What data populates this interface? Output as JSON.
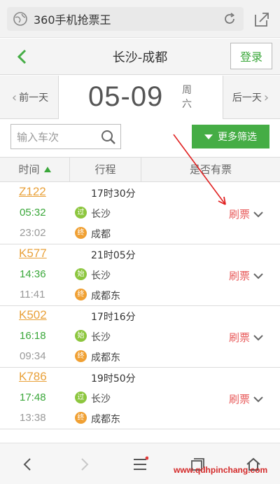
{
  "browser": {
    "url_title": "360手机抢票王"
  },
  "header": {
    "title": "长沙-成都",
    "login_label": "登录"
  },
  "date_nav": {
    "prev_label": "前一天",
    "next_label": "后一天",
    "date": "05-09",
    "weekday_line1": "周",
    "weekday_line2": "六"
  },
  "search": {
    "placeholder": "输入车次"
  },
  "filter": {
    "label": "更多筛选"
  },
  "columns": {
    "time": "时间",
    "route": "行程",
    "availability": "是否有票"
  },
  "trains": [
    {
      "number": "Z122",
      "duration": "17时30分",
      "depart": "05:32",
      "arrive": "23:02",
      "from_badge": "过",
      "from": "长沙",
      "to_badge": "终",
      "to": "成都",
      "action": "刷票"
    },
    {
      "number": "K577",
      "duration": "21时05分",
      "depart": "14:36",
      "arrive": "11:41",
      "from_badge": "始",
      "from": "长沙",
      "to_badge": "终",
      "to": "成都东",
      "action": "刷票"
    },
    {
      "number": "K502",
      "duration": "17时16分",
      "depart": "16:18",
      "arrive": "09:34",
      "from_badge": "始",
      "from": "长沙",
      "to_badge": "终",
      "to": "成都东",
      "action": "刷票"
    },
    {
      "number": "K786",
      "duration": "19时50分",
      "depart": "17:48",
      "arrive": "13:38",
      "from_badge": "过",
      "from": "长沙",
      "to_badge": "终",
      "to": "成都东",
      "action": "刷票"
    }
  ],
  "watermark": "www.qdhpinchang.com",
  "colors": {
    "accent_green": "#45ad45",
    "train_number": "#e9a13a",
    "refresh_red": "#e85b5b"
  }
}
